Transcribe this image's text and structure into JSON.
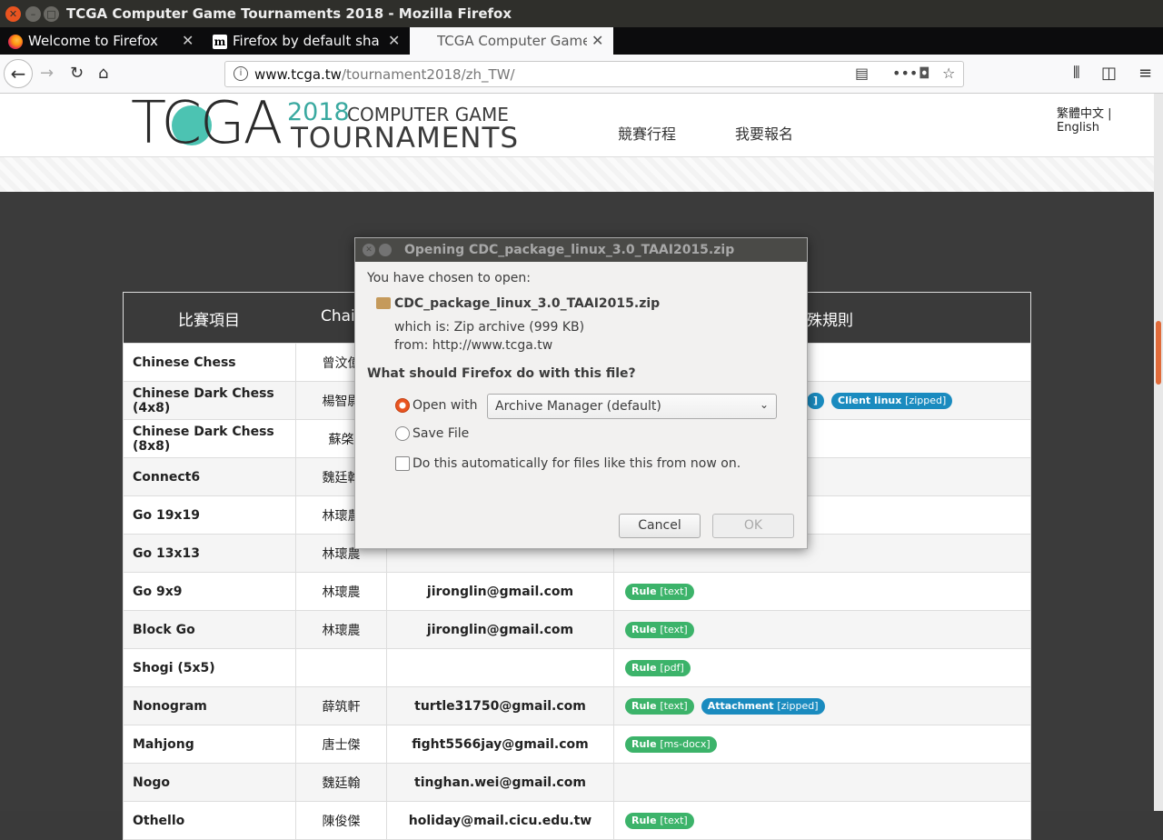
{
  "window": {
    "title": "TCGA Computer Game Tournaments 2018 - Mozilla Firefox"
  },
  "tabs": [
    {
      "label": "Welcome to Firefox",
      "icon": "firefox-icon"
    },
    {
      "label": "Firefox by default shares",
      "icon": "medium-m-icon"
    },
    {
      "label": "TCGA Computer Game Tournaments",
      "icon": "none"
    }
  ],
  "nav": {
    "url_host": "www.tcga.tw",
    "url_path": "/tournament2018/zh_TW/"
  },
  "site": {
    "logo": {
      "tcga": "TCGA",
      "year": "2018",
      "line1": "COMPUTER GAME",
      "line2": "TOURNAMENTS"
    },
    "menu": [
      "競賽行程",
      "我要報名"
    ],
    "lang_zh": "繁體中文",
    "lang_sep": "|",
    "lang_en": "English"
  },
  "table": {
    "headers": [
      "比賽項目",
      "Chai",
      "",
      "殊規則"
    ],
    "rows": [
      {
        "game": "Chinese Chess",
        "chair": "曾汶億",
        "email": "",
        "badges": []
      },
      {
        "game": "Chinese Dark Chess (4x8)",
        "chair": "楊智尉",
        "email": "",
        "badges": [
          {
            "label": "",
            "type": "",
            "color": "blue",
            "partial": "]"
          },
          {
            "label": "Client linux",
            "type": "[zipped]",
            "color": "blue"
          }
        ]
      },
      {
        "game": "Chinese Dark Chess (8x8)",
        "chair": "蘇棨",
        "email": "",
        "badges": []
      },
      {
        "game": "Connect6",
        "chair": "魏廷翰",
        "email": "",
        "badges": []
      },
      {
        "game": "Go 19x19",
        "chair": "林瓌農",
        "email": "",
        "badges": []
      },
      {
        "game": "Go 13x13",
        "chair": "林瓌農",
        "email": "",
        "badges": []
      },
      {
        "game": "Go 9x9",
        "chair": "林瓌農",
        "email": "jironglin@gmail.com",
        "badges": [
          {
            "label": "Rule",
            "type": "[text]",
            "color": "green"
          }
        ]
      },
      {
        "game": "Block Go",
        "chair": "林瓌農",
        "email": "jironglin@gmail.com",
        "badges": [
          {
            "label": "Rule",
            "type": "[text]",
            "color": "green"
          }
        ]
      },
      {
        "game": "Shogi (5x5)",
        "chair": "",
        "email": "",
        "badges": [
          {
            "label": "Rule",
            "type": "[pdf]",
            "color": "green"
          }
        ]
      },
      {
        "game": "Nonogram",
        "chair": "薛筑軒",
        "email": "turtle31750@gmail.com",
        "badges": [
          {
            "label": "Rule",
            "type": "[text]",
            "color": "green"
          },
          {
            "label": "Attachment",
            "type": "[zipped]",
            "color": "blue"
          }
        ]
      },
      {
        "game": "Mahjong",
        "chair": "唐士傑",
        "email": "fight5566jay@gmail.com",
        "badges": [
          {
            "label": "Rule",
            "type": "[ms-docx]",
            "color": "green"
          }
        ]
      },
      {
        "game": "Nogo",
        "chair": "魏廷翰",
        "email": "tinghan.wei@gmail.com",
        "badges": []
      },
      {
        "game": "Othello",
        "chair": "陳俊傑",
        "email": "holiday@mail.cicu.edu.tw",
        "badges": [
          {
            "label": "Rule",
            "type": "[text]",
            "color": "green"
          }
        ]
      }
    ]
  },
  "dialog": {
    "title": "Opening CDC_package_linux_3.0_TAAI2015.zip",
    "chosen": "You have chosen to open:",
    "filename": "CDC_package_linux_3.0_TAAI2015.zip",
    "which_is": "which is:  Zip archive (999 KB)",
    "from": "from:  http://www.tcga.tw",
    "question": "What should Firefox do with this file?",
    "open_with_label": "Open with",
    "open_with_value": "Archive Manager (default)",
    "save_label": "Save File",
    "auto_label": "Do this automatically for files like this from now on.",
    "cancel": "Cancel",
    "ok": "OK",
    "selected_option": "open_with"
  },
  "colors": {
    "accent": "#e95420",
    "green_badge": "#3cb36a",
    "blue_badge": "#1a8bbf",
    "teal_logo": "#3aa9a0"
  }
}
